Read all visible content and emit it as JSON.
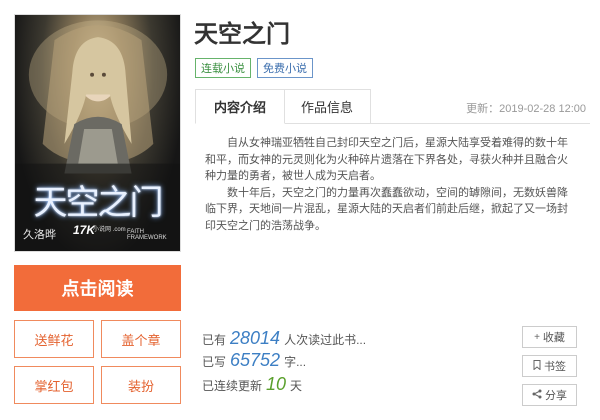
{
  "cover": {
    "title_text": "天空之门",
    "author": "久洛晔",
    "logo": "17K",
    "logo_sub": "小说网 .com",
    "tagline": "FAITH FRAMEWORK"
  },
  "actions": {
    "read": "点击阅读",
    "flowers": "送鲜花",
    "stamp": "盖个章",
    "red_packet": "掌红包",
    "dress_up": "装扮"
  },
  "book": {
    "title": "天空之门",
    "tags": [
      "连载小说",
      "免费小说"
    ]
  },
  "tabs": [
    "内容介绍",
    "作品信息"
  ],
  "update": "更新：2019-02-28 12:00",
  "intro": [
    "自从女神瑞亚牺牲自己封印天空之门后，星源大陆享受着难得的数十年和平，而女神的元灵则化为火种碎片遗落在下界各处，寻获火种并且融合火种力量的勇者，被世人成为天启者。",
    "数十年后，天空之门的力量再次蠢蠢欲动，空间的罅隙间，无数妖兽降临下界，天地间一片混乱，星源大陆的天启者们前赴后继，掀起了又一场封印天空之门的浩荡战争。"
  ],
  "stats": {
    "reads": {
      "prefix": "已有",
      "value": "28014",
      "suffix": "人次读过此书..."
    },
    "words": {
      "prefix": "已写",
      "value": "65752",
      "suffix": "字..."
    },
    "streak": {
      "prefix": "已连续更新",
      "value": "10",
      "suffix": "天"
    }
  },
  "side": {
    "collect": "收藏",
    "bookmark": "书签",
    "share": "分享"
  },
  "colors": {
    "accent": "#f26c3a",
    "num_blue": "#3d7fc4",
    "num_green": "#5aa02c"
  }
}
